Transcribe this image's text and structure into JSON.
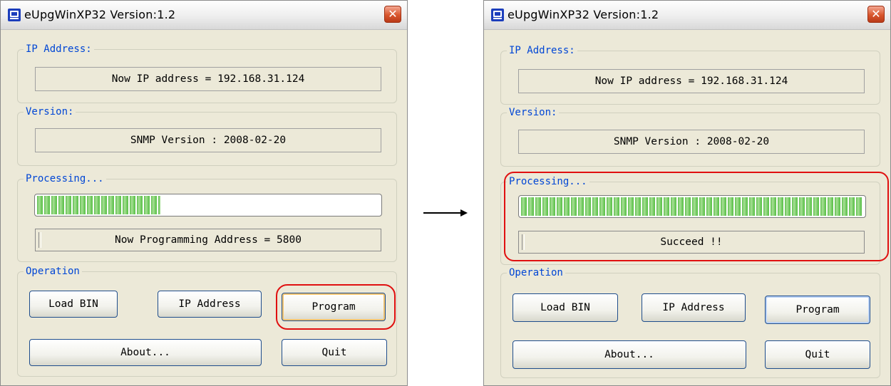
{
  "left_window": {
    "title": "eUpgWinXP32 Version:1.2",
    "close_glyph": "✕",
    "ip_group_label": "IP Address:",
    "ip_text": "Now IP address = 192.168.31.124",
    "version_group_label": "Version:",
    "version_text": "SNMP Version : 2008-02-20",
    "processing_group_label": "Processing...",
    "progress_fraction": 0.36,
    "status_text": "Now Programming Address = 5800",
    "operation_group_label": "Operation",
    "load_bin_label": "Load BIN",
    "ip_address_button_label": "IP Address",
    "program_label": "Program",
    "about_label": "About...",
    "quit_label": "Quit"
  },
  "right_window": {
    "title": "eUpgWinXP32 Version:1.2",
    "close_glyph": "✕",
    "ip_group_label": "IP Address:",
    "ip_text": "Now IP address = 192.168.31.124",
    "version_group_label": "Version:",
    "version_text": "SNMP Version : 2008-02-20",
    "processing_group_label": "Processing...",
    "progress_fraction": 1.0,
    "status_text": "Succeed !!",
    "operation_group_label": "Operation",
    "load_bin_label": "Load BIN",
    "ip_address_button_label": "IP Address",
    "program_label": "Program",
    "about_label": "About...",
    "quit_label": "Quit"
  },
  "icons": {
    "app": "app-icon",
    "close": "close-icon",
    "transition": "arrow-right-icon"
  },
  "colors": {
    "legend_text": "#0046d5",
    "highlight_red": "#e01010",
    "progress_green": "#62c350"
  }
}
